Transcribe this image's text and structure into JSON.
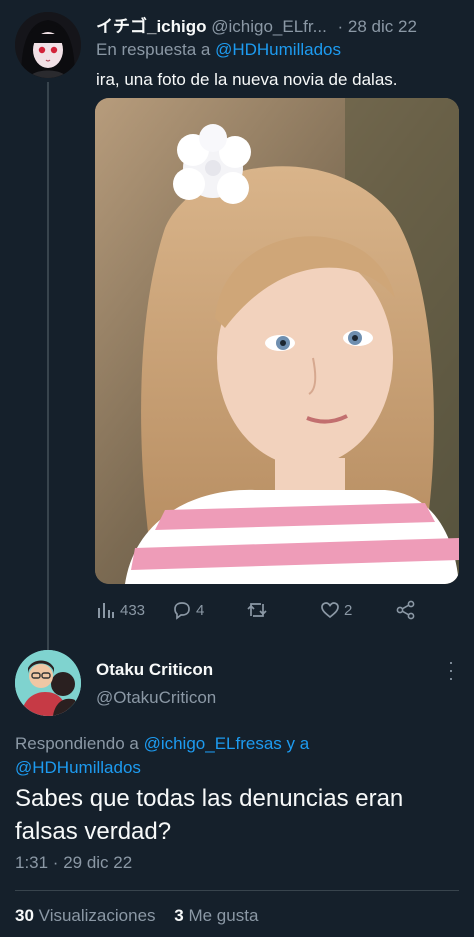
{
  "tweet1": {
    "display_name": "イチゴ_ichigo",
    "handle": "@ichigo_ELfr...",
    "date": "· 28 dic 22",
    "reply_prefix": "En respuesta a",
    "reply_mention": "@HDHumillados",
    "text": "ira, una foto de la nueva novia de dalas.",
    "views": "433",
    "replies": "4",
    "retweets": "",
    "likes": "2"
  },
  "tweet2": {
    "display_name": "Otaku Criticon",
    "handle": "@OtakuCriticon",
    "replying_prefix": "Respondiendo a",
    "replying_mentions": "@ichigo_ELfresas y a",
    "replying_mentions2": "@HDHumillados",
    "text": "Sabes que todas las denuncias eran falsas verdad?",
    "timestamp": "1:31 · 29 dic 22",
    "views_count": "30",
    "views_label": "Visualizaciones",
    "likes_count": "3",
    "likes_label": "Me gusta"
  },
  "icons": {
    "views": "bar-chart-icon",
    "reply": "reply-icon",
    "retweet": "retweet-icon",
    "like": "heart-icon",
    "share": "share-icon",
    "more": "more-icon"
  },
  "colors": {
    "background": "#15202b",
    "text": "#f7f9f9",
    "muted": "#8b98a5",
    "link": "#1d9bf0",
    "divider": "#38444d"
  }
}
